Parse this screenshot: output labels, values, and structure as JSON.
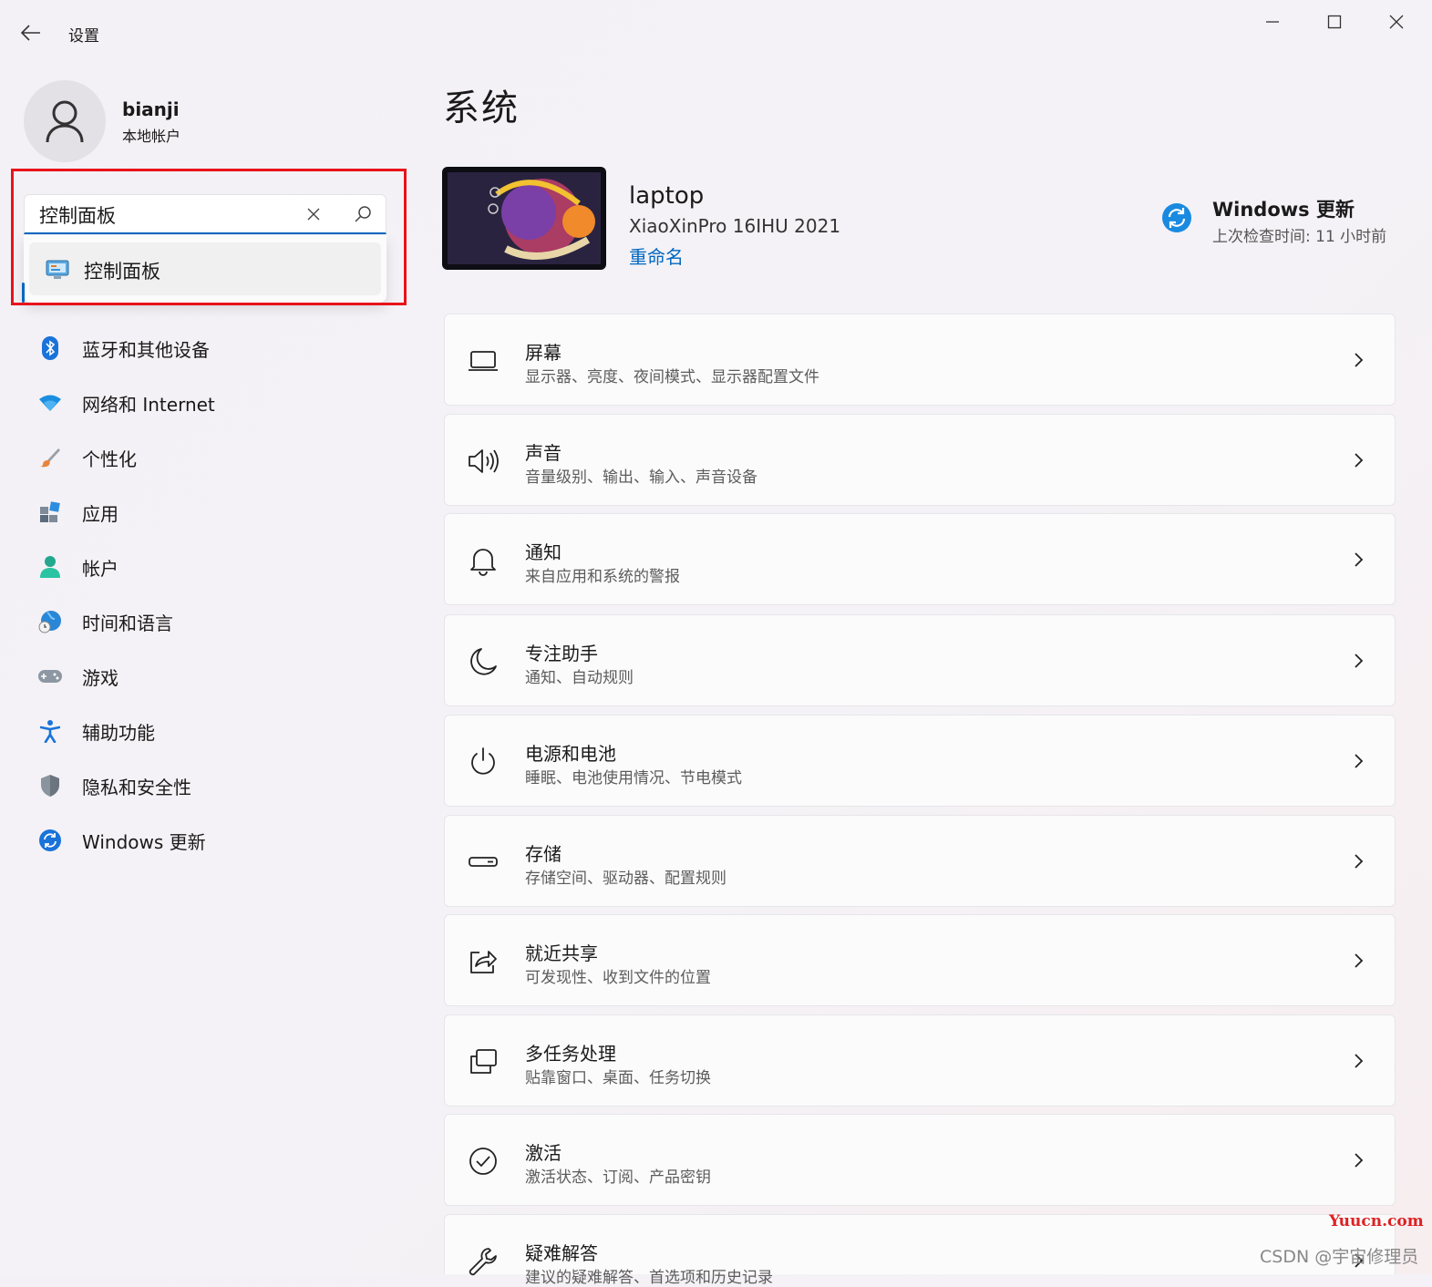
{
  "window": {
    "title": "设置",
    "minimize": "─",
    "maximize": "☐",
    "close": "✕"
  },
  "profile": {
    "name": "bianji",
    "account_type": "本地帐户"
  },
  "search": {
    "value": "控制面板",
    "suggestion": "控制面板"
  },
  "nav": [
    {
      "label": "蓝牙和其他设备",
      "icon": "bluetooth-icon"
    },
    {
      "label": "网络和 Internet",
      "icon": "wifi-icon"
    },
    {
      "label": "个性化",
      "icon": "brush-icon"
    },
    {
      "label": "应用",
      "icon": "apps-icon"
    },
    {
      "label": "帐户",
      "icon": "person-icon"
    },
    {
      "label": "时间和语言",
      "icon": "globe-clock-icon"
    },
    {
      "label": "游戏",
      "icon": "gamepad-icon"
    },
    {
      "label": "辅助功能",
      "icon": "accessibility-icon"
    },
    {
      "label": "隐私和安全性",
      "icon": "shield-icon"
    },
    {
      "label": "Windows 更新",
      "icon": "update-icon"
    }
  ],
  "main": {
    "title": "系统",
    "device": {
      "name": "laptop",
      "model": "XiaoXinPro 16IHU 2021",
      "rename": "重命名"
    },
    "update": {
      "title": "Windows 更新",
      "subtitle": "上次检查时间: 11 小时前"
    },
    "cards": [
      {
        "title": "屏幕",
        "subtitle": "显示器、亮度、夜间模式、显示器配置文件",
        "icon": "display-icon"
      },
      {
        "title": "声音",
        "subtitle": "音量级别、输出、输入、声音设备",
        "icon": "speaker-icon"
      },
      {
        "title": "通知",
        "subtitle": "来自应用和系统的警报",
        "icon": "bell-icon"
      },
      {
        "title": "专注助手",
        "subtitle": "通知、自动规则",
        "icon": "moon-icon"
      },
      {
        "title": "电源和电池",
        "subtitle": "睡眠、电池使用情况、节电模式",
        "icon": "power-icon"
      },
      {
        "title": "存储",
        "subtitle": "存储空间、驱动器、配置规则",
        "icon": "storage-icon"
      },
      {
        "title": "就近共享",
        "subtitle": "可发现性、收到文件的位置",
        "icon": "share-icon"
      },
      {
        "title": "多任务处理",
        "subtitle": "贴靠窗口、桌面、任务切换",
        "icon": "multitask-icon"
      },
      {
        "title": "激活",
        "subtitle": "激活状态、订阅、产品密钥",
        "icon": "check-circle-icon"
      },
      {
        "title": "疑难解答",
        "subtitle": "建议的疑难解答、首选项和历史记录",
        "icon": "wrench-icon"
      }
    ]
  },
  "watermark": {
    "site": "Yuucn.com",
    "credit": "CSDN @宇宙修理员"
  },
  "colors": {
    "accent": "#0067c0",
    "highlight_box": "#e8131b"
  }
}
